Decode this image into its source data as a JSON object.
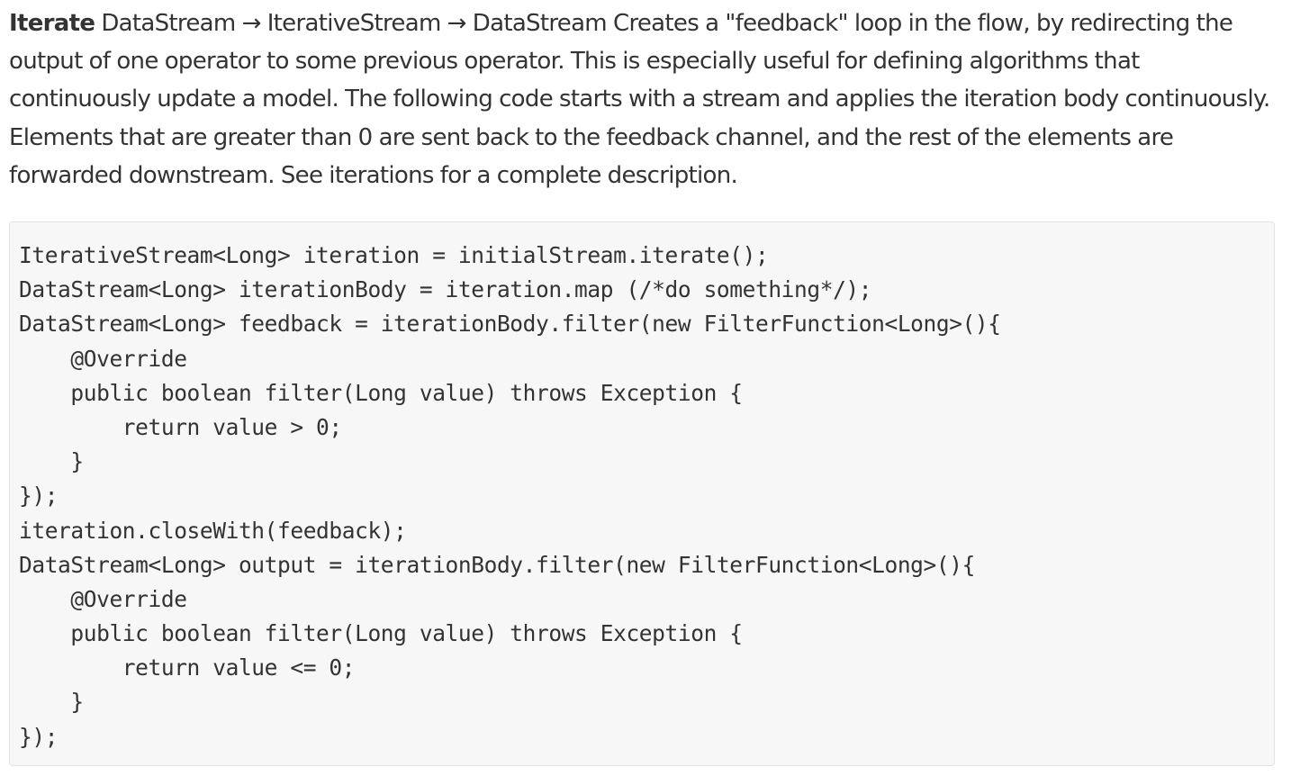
{
  "description": {
    "operator_name": "Iterate",
    "text": " DataStream → IterativeStream → DataStream Creates a \"feedback\" loop in the flow, by redirecting the output of one operator to some previous operator. This is especially useful for defining algorithms that continuously update a model. The following code starts with a stream and applies the iteration body continuously. Elements that are greater than 0 are sent back to the feedback channel, and the rest of the elements are forwarded downstream. See iterations for a complete description."
  },
  "code": {
    "lines": [
      "IterativeStream<Long> iteration = initialStream.iterate();",
      "DataStream<Long> iterationBody = iteration.map (/*do something*/);",
      "DataStream<Long> feedback = iterationBody.filter(new FilterFunction<Long>(){",
      "    @Override",
      "    public boolean filter(Long value) throws Exception {",
      "        return value > 0;",
      "    }",
      "});",
      "iteration.closeWith(feedback);",
      "DataStream<Long> output = iterationBody.filter(new FilterFunction<Long>(){",
      "    @Override",
      "    public boolean filter(Long value) throws Exception {",
      "        return value <= 0;",
      "    }",
      "});"
    ]
  }
}
